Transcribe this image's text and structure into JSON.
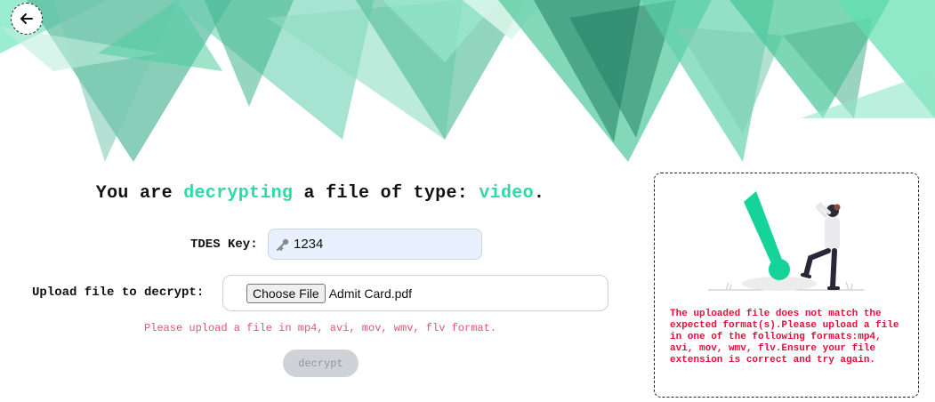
{
  "header": {
    "back_icon": "arrow-left-icon"
  },
  "headline": {
    "prefix": "You are ",
    "action": "decrypting",
    "middle": " a file of type: ",
    "file_type": "video",
    "suffix": "."
  },
  "form": {
    "key_label": "TDES Key:",
    "key_icon": "key-icon",
    "key_value": "1234",
    "upload_label": "Upload file to decrypt:",
    "choose_file_label": "Choose File",
    "file_name": "Admit Card.pdf",
    "error_text": "Please upload a file in mp4, avi, mov, wmv, flv format.",
    "decrypt_label": "decrypt"
  },
  "panel": {
    "illustration": "warning-person-illustration",
    "message": "The uploaded file does not match the expected format(s).Please upload a file in one of the following formats:mp4, avi, mov, wmv, flv.Ensure your file extension is correct and try again."
  },
  "colors": {
    "accent": "#2fd9a3",
    "error": "#e0576f",
    "panel_error": "#e0103a",
    "banner_light": "#5ee8b9",
    "banner_dark": "#2a7c62"
  }
}
